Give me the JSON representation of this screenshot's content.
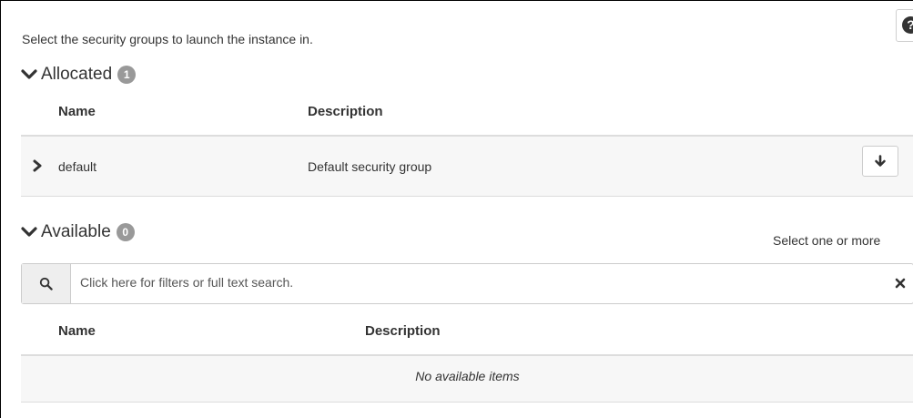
{
  "intro_text": "Select the security groups to launch the instance in.",
  "help_icon": "question-circle-icon",
  "allocated": {
    "title": "Allocated",
    "count": "1",
    "columns": {
      "name": "Name",
      "description": "Description"
    },
    "rows": [
      {
        "name": "default",
        "description": "Default security group",
        "action_icon": "arrow-down-icon"
      }
    ]
  },
  "available": {
    "title": "Available",
    "count": "0",
    "select_hint": "Select one or more",
    "search": {
      "placeholder": "Click here for filters or full text search.",
      "icons": {
        "search": "search-icon",
        "clear": "close-icon"
      }
    },
    "columns": {
      "name": "Name",
      "description": "Description"
    },
    "empty_text": "No available items"
  },
  "colors": {
    "badge": "#999999",
    "row_bg": "#f7f7f7",
    "border": "#dddddd",
    "text": "#333333"
  }
}
